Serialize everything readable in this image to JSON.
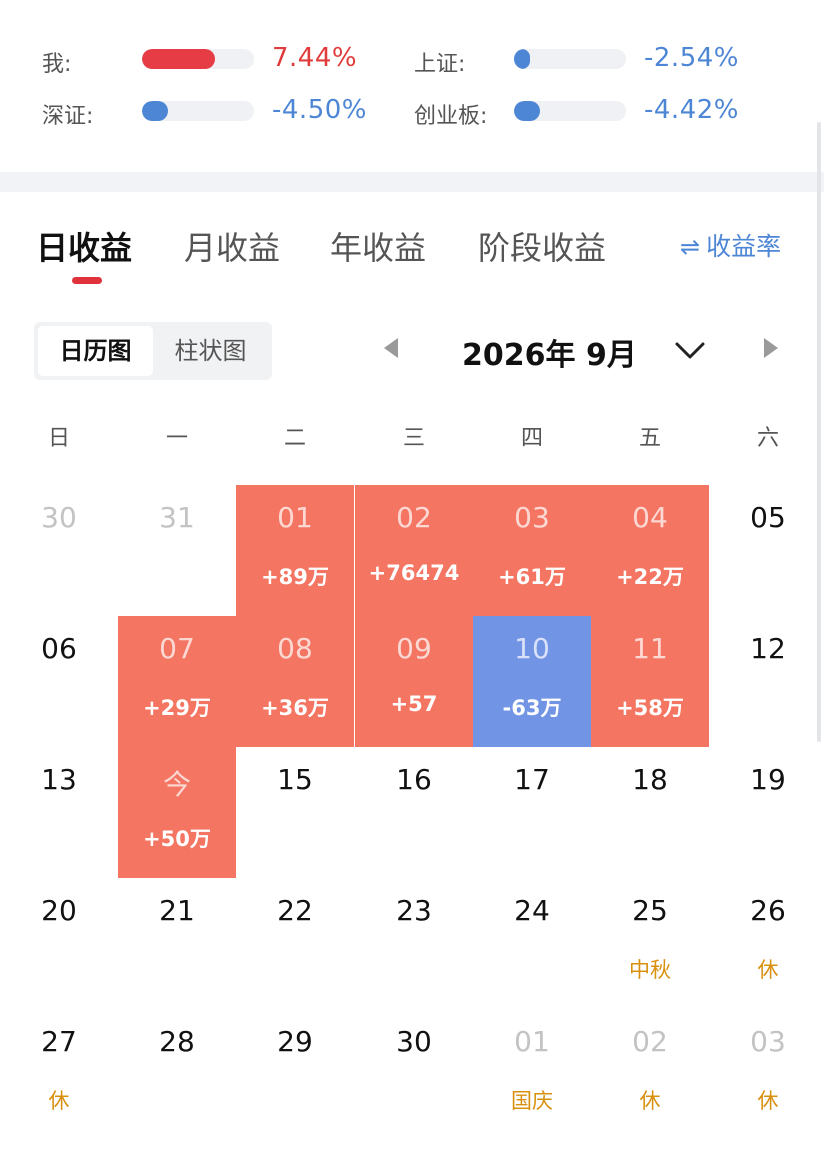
{
  "comparison": [
    {
      "label": "我:",
      "value": "7.44%",
      "fill": 0.65,
      "color": "#e53c45",
      "tone": "red-v"
    },
    {
      "label": "上证:",
      "value": "-2.54%",
      "fill": 0.14,
      "color": "#4e86d6",
      "tone": "blue-v"
    },
    {
      "label": "深证:",
      "value": "-4.50%",
      "fill": 0.23,
      "color": "#4e86d6",
      "tone": "blue-v"
    },
    {
      "label": "创业板:",
      "value": "-4.42%",
      "fill": 0.23,
      "color": "#4e86d6",
      "tone": "blue-v"
    }
  ],
  "tabs": [
    {
      "label": "日收益",
      "active": true
    },
    {
      "label": "月收益",
      "active": false
    },
    {
      "label": "年收益",
      "active": false
    },
    {
      "label": "阶段收益",
      "active": false
    }
  ],
  "rate_link": {
    "icon": "swap-arrows-icon",
    "label": "收益率"
  },
  "view_switch": [
    {
      "label": "日历图",
      "active": true
    },
    {
      "label": "柱状图",
      "active": false
    }
  ],
  "month_nav": {
    "title": "2026年 9月"
  },
  "weekdays": [
    "日",
    "一",
    "二",
    "三",
    "四",
    "五",
    "六"
  ],
  "weeks": [
    [
      {
        "day": "30",
        "muted": true
      },
      {
        "day": "31",
        "muted": true
      },
      {
        "day": "01",
        "pnl": "+89万",
        "tone": "pos"
      },
      {
        "day": "02",
        "pnl": "+76474",
        "tone": "pos"
      },
      {
        "day": "03",
        "pnl": "+61万",
        "tone": "pos"
      },
      {
        "day": "04",
        "pnl": "+22万",
        "tone": "pos"
      },
      {
        "day": "05"
      }
    ],
    [
      {
        "day": "06"
      },
      {
        "day": "07",
        "pnl": "+29万",
        "tone": "pos"
      },
      {
        "day": "08",
        "pnl": "+36万",
        "tone": "pos"
      },
      {
        "day": "09",
        "pnl": "+57",
        "tone": "pos"
      },
      {
        "day": "10",
        "pnl": "-63万",
        "tone": "neg"
      },
      {
        "day": "11",
        "pnl": "+58万",
        "tone": "pos"
      },
      {
        "day": "12"
      }
    ],
    [
      {
        "day": "13"
      },
      {
        "day": "今",
        "pnl": "+50万",
        "tone": "pos"
      },
      {
        "day": "15"
      },
      {
        "day": "16"
      },
      {
        "day": "17"
      },
      {
        "day": "18"
      },
      {
        "day": "19"
      }
    ],
    [
      {
        "day": "20"
      },
      {
        "day": "21"
      },
      {
        "day": "22"
      },
      {
        "day": "23"
      },
      {
        "day": "24"
      },
      {
        "day": "25",
        "holiday": "中秋"
      },
      {
        "day": "26",
        "holiday": "休"
      }
    ],
    [
      {
        "day": "27",
        "holiday": "休"
      },
      {
        "day": "28"
      },
      {
        "day": "29"
      },
      {
        "day": "30"
      },
      {
        "day": "01",
        "muted": true,
        "holiday": "国庆"
      },
      {
        "day": "02",
        "muted": true,
        "holiday": "休"
      },
      {
        "day": "03",
        "muted": true,
        "holiday": "休"
      }
    ]
  ]
}
